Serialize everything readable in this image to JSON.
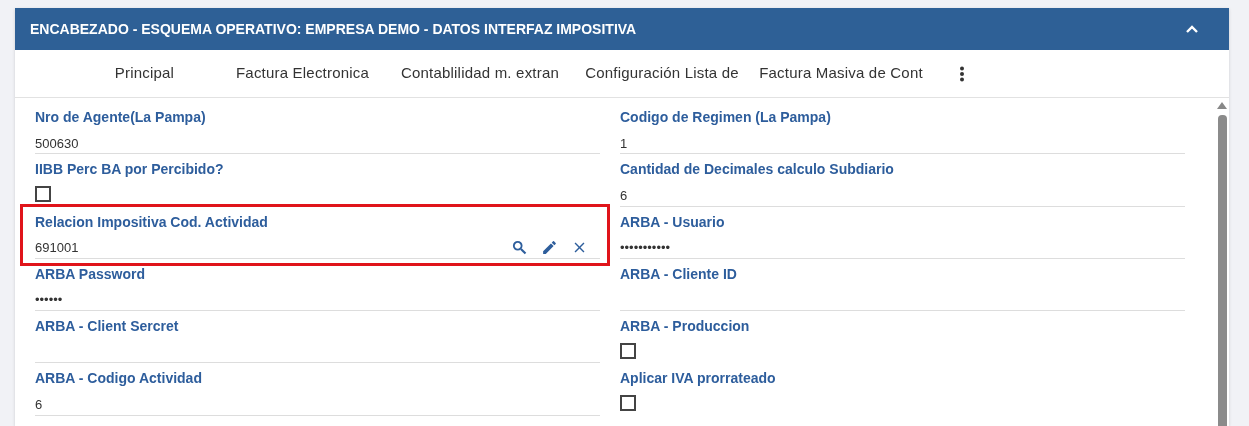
{
  "panel": {
    "title": "ENCABEZADO - ESQUEMA OPERATIVO: EMPRESA DEMO - DATOS INTERFAZ IMPOSITIVA",
    "expanded": true
  },
  "tabs": [
    {
      "label": "Principal",
      "selected": false
    },
    {
      "label": "Factura Electronica",
      "selected": false
    },
    {
      "label": "Contablilidad m. extran",
      "selected": false
    },
    {
      "label": "Configuración Lista de",
      "selected": false
    },
    {
      "label": "Factura Masiva de Cont",
      "selected": false
    }
  ],
  "left_column": [
    {
      "kind": "text",
      "label": "Nro de Agente(La Pampa)",
      "value": "500630"
    },
    {
      "kind": "checkbox",
      "label": "IIBB Perc BA por Percibido?",
      "checked": false
    },
    {
      "kind": "lookup",
      "label": "Relacion Impositiva Cod. Actividad",
      "value": "691001",
      "highlighted": true
    },
    {
      "kind": "text",
      "label": "ARBA Password",
      "value": "••••••"
    },
    {
      "kind": "text",
      "label": "ARBA - Client Sercret"
    },
    {
      "kind": "text",
      "label": "ARBA - Codigo Actividad",
      "value": "6"
    }
  ],
  "right_column": [
    {
      "kind": "text",
      "label": "Codigo de Regimen (La Pampa)",
      "value": "1"
    },
    {
      "kind": "text",
      "label": "Cantidad de Decimales calculo Subdiario",
      "value": "6"
    },
    {
      "kind": "text",
      "label": "ARBA - Usuario",
      "value": "•••••••••••"
    },
    {
      "kind": "text",
      "label": "ARBA - Cliente ID"
    },
    {
      "kind": "checkbox",
      "label": "ARBA - Produccion",
      "checked": false
    },
    {
      "kind": "checkbox",
      "label": "Aplicar IVA prorrateado",
      "checked": false
    }
  ]
}
